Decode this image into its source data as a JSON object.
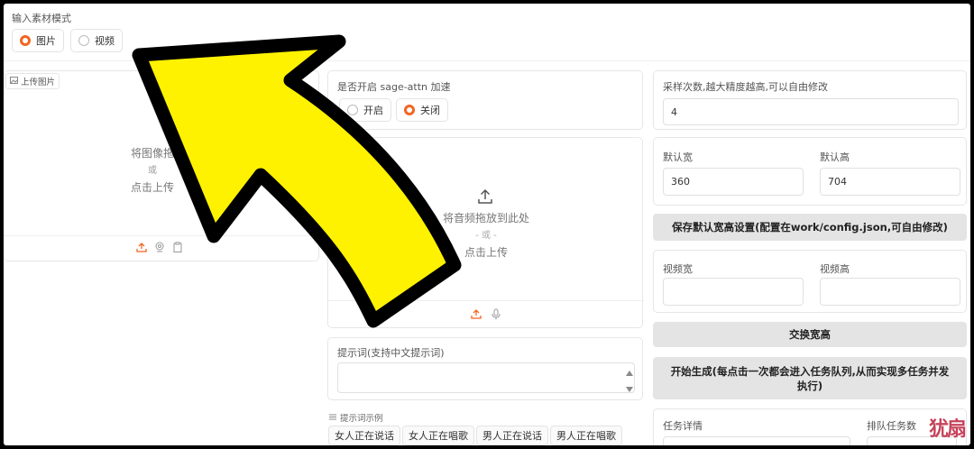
{
  "input_mode": {
    "title": "输入素材模式",
    "options": [
      {
        "label": "图片",
        "selected": true
      },
      {
        "label": "视频",
        "selected": false
      }
    ]
  },
  "image_upload": {
    "tag": "上传图片",
    "drop_text": "将图像拖",
    "or_text": "或",
    "click_text": "点击上传"
  },
  "sage_attn": {
    "title": "是否开启 sage-attn 加速",
    "options": [
      {
        "label": "开启",
        "selected": false
      },
      {
        "label": "关闭",
        "selected": true
      }
    ]
  },
  "audio_upload": {
    "drop_text": "将音频拖放到此处",
    "or_text": "- 或 -",
    "click_text": "点击上传"
  },
  "prompt": {
    "label": "提示词(支持中文提示词)",
    "value": ""
  },
  "prompt_examples": {
    "label": "提示词示例",
    "chips": [
      "女人正在说话",
      "女人正在唱歌",
      "男人正在说话",
      "男人正在唱歌"
    ]
  },
  "sampling": {
    "label": "采样次数,越大精度越高,可以自由修改",
    "value": "4"
  },
  "default_size": {
    "width_label": "默认宽",
    "width_value": "360",
    "height_label": "默认高",
    "height_value": "704"
  },
  "save_button": "保存默认宽高设置(配置在work/config.json,可自由修改)",
  "video_size": {
    "width_label": "视频宽",
    "height_label": "视频高"
  },
  "swap_button": "交换宽高",
  "generate_button": "开始生成(每点击一次都会进入任务队列,从而实现多任务并发执行)",
  "task_details": {
    "label": "任务详情",
    "queue_label": "排队任务数"
  },
  "colors": {
    "accent": "#f26522",
    "arrow_fill": "#fff200",
    "arrow_stroke": "#000000"
  }
}
